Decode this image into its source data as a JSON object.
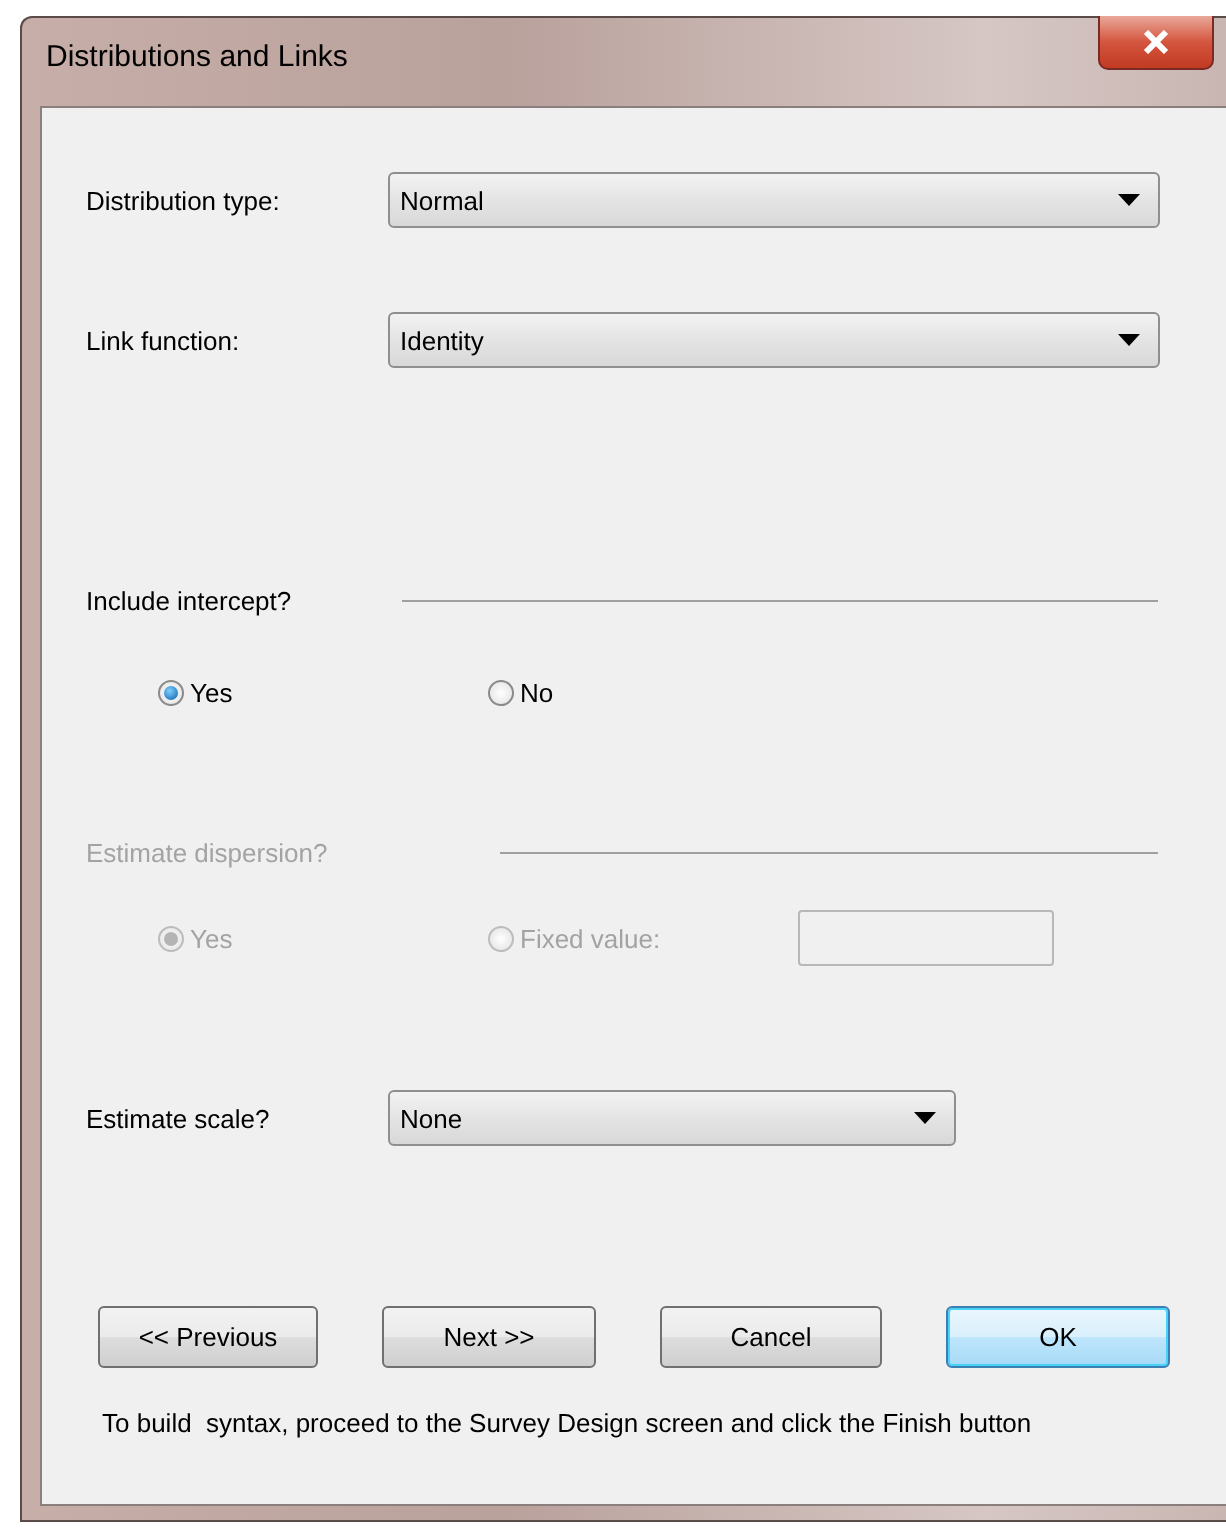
{
  "window": {
    "title": "Distributions and Links"
  },
  "fields": [
    {
      "label": "Distribution type:",
      "value": "Normal"
    },
    {
      "label": "Link function:",
      "value": "Identity"
    }
  ],
  "intercept": {
    "heading": "Include intercept?",
    "disabled": false,
    "options": [
      {
        "label": "Yes",
        "selected": true
      },
      {
        "label": "No",
        "selected": false
      }
    ]
  },
  "dispersion": {
    "heading": "Estimate dispersion?",
    "disabled": true,
    "options": [
      {
        "label": "Yes",
        "selected": true
      },
      {
        "label": "Fixed value:",
        "selected": false
      }
    ]
  },
  "scale": {
    "label": "Estimate scale?",
    "value": "None"
  },
  "buttons": [
    {
      "label": "<< Previous",
      "default": false
    },
    {
      "label": "Next >>",
      "default": false
    },
    {
      "label": "Cancel",
      "default": false
    },
    {
      "label": "OK",
      "default": true
    }
  ],
  "note": "To build  syntax, proceed to the Survey Design screen and click the Finish button"
}
